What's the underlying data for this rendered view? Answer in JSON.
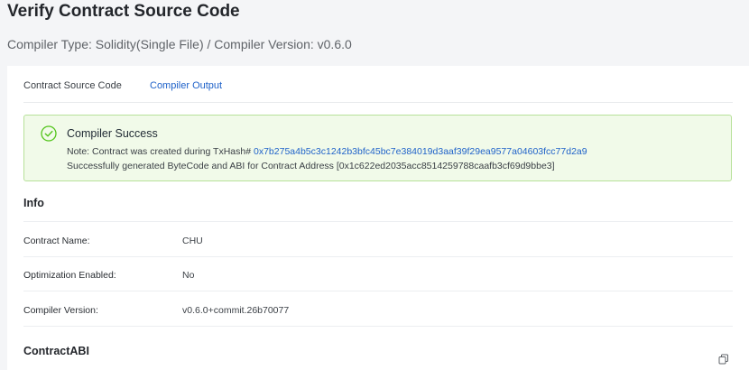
{
  "header": {
    "title": "Verify Contract Source Code",
    "subtitle": "Compiler Type: Solidity(Single File) / Compiler Version: v0.6.0"
  },
  "tabs": [
    {
      "label": "Contract Source Code",
      "active": false
    },
    {
      "label": "Compiler Output",
      "active": true
    }
  ],
  "alert": {
    "title": "Compiler Success",
    "note_prefix": "Note: Contract was created during TxHash# ",
    "tx_hash": "0x7b275a4b5c3c1242b3bfc45bc7e384019d3aaf39f29ea9577a04603fcc77d2a9",
    "success_text": "Successfully generated ByteCode and ABI for Contract Address [0x1c622ed2035acc8514259788caafb3cf69d9bbe3]",
    "icon": "check-circle-icon",
    "color": "#52c41a"
  },
  "info": {
    "title": "Info",
    "rows": [
      {
        "label": "Contract Name:",
        "value": "CHU"
      },
      {
        "label": "Optimization Enabled:",
        "value": "No"
      },
      {
        "label": "Compiler Version:",
        "value": "v0.6.0+commit.26b70077"
      }
    ]
  },
  "abi": {
    "title": "ContractABI",
    "copy_icon": "copy-icon"
  },
  "colors": {
    "link": "#1f62c9",
    "success_bg": "#f1fae9",
    "success_border": "#b7e19a"
  }
}
